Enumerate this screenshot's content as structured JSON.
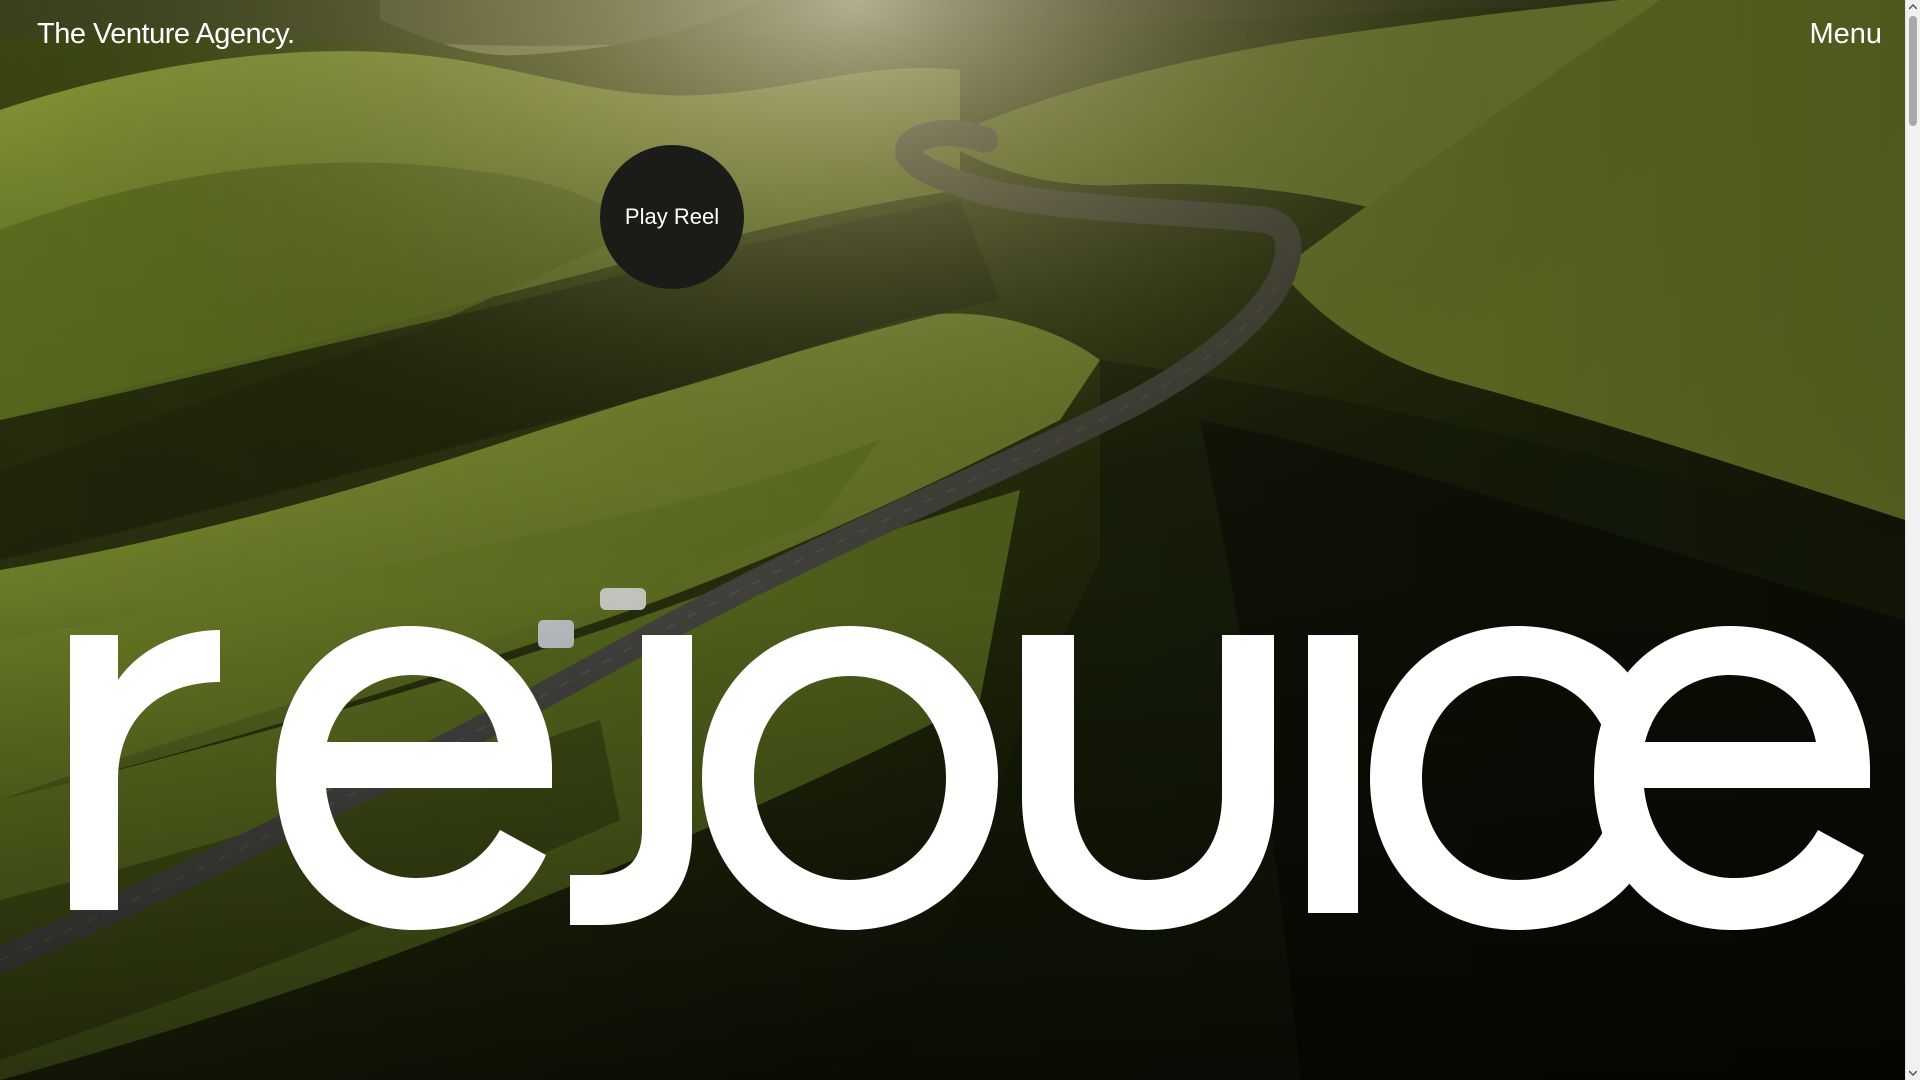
{
  "header": {
    "brand": "The Venture Agency.",
    "menu_label": "Menu"
  },
  "hero": {
    "play_reel_label": "Play Reel",
    "wordmark": "rejouice",
    "background": "aerial-green-hills-winding-road-photo"
  },
  "colors": {
    "text": "#ffffff",
    "play_button_bg": "#1b1b17",
    "grass_light": "#7c8f2c",
    "grass_dark": "#1f2a0c",
    "road": "#4d4b47"
  },
  "scrollbar": {
    "up_icon": "chevron-up-icon",
    "down_icon": "chevron-down-icon"
  }
}
